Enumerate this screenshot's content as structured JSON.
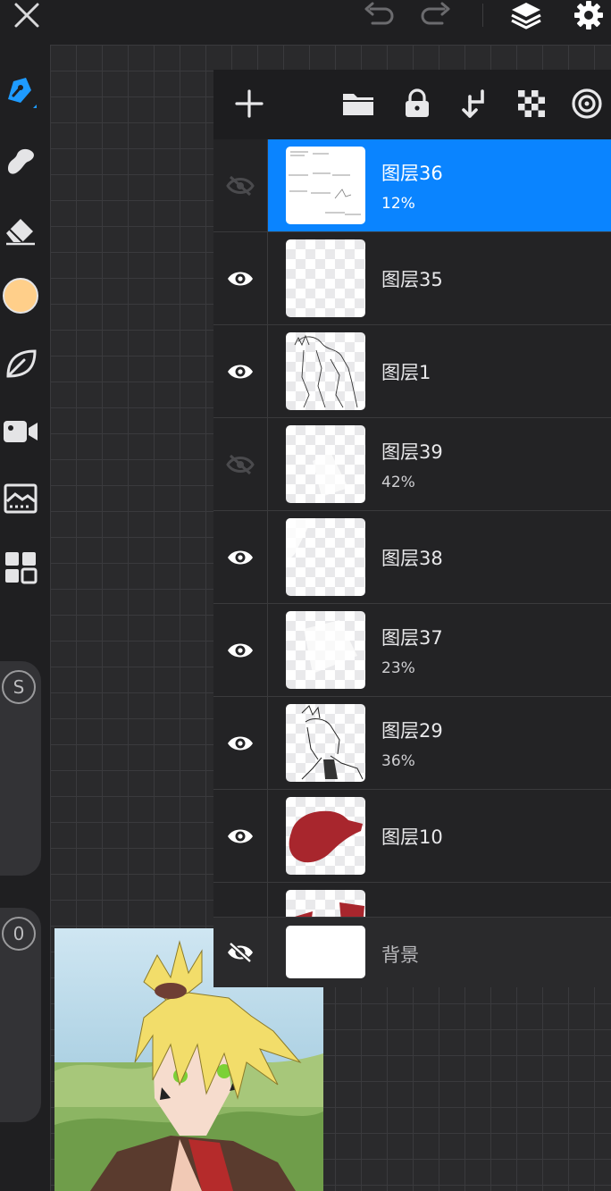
{
  "top_bar": {
    "icons": [
      "close-icon",
      "undo-icon",
      "redo-icon",
      "layers-icon",
      "settings-icon"
    ]
  },
  "left_toolbar": {
    "tools": [
      "brush-icon",
      "smudge-icon",
      "eraser-icon",
      "color-swatch",
      "leaf-icon",
      "camera-icon",
      "reference-image-icon",
      "gallery-grid-icon"
    ],
    "current_color": "#ffcf8a",
    "size_slider_label": "S",
    "opacity_slider_label": "0"
  },
  "layer_panel": {
    "toolbar_icons": [
      "add-layer-icon",
      "folder-icon",
      "lock-icon",
      "merge-down-icon",
      "transparency-icon",
      "blend-mode-icon"
    ],
    "accent_color": "#0a84ff",
    "layers": [
      {
        "name": "图层36",
        "opacity": "12%",
        "visible": false,
        "selected": true
      },
      {
        "name": "图层35",
        "opacity": "",
        "visible": true,
        "selected": false
      },
      {
        "name": "图层1",
        "opacity": "",
        "visible": true,
        "selected": false
      },
      {
        "name": "图层39",
        "opacity": "42%",
        "visible": false,
        "selected": false
      },
      {
        "name": "图层38",
        "opacity": "",
        "visible": true,
        "selected": false
      },
      {
        "name": "图层37",
        "opacity": "23%",
        "visible": true,
        "selected": false
      },
      {
        "name": "图层29",
        "opacity": "36%",
        "visible": true,
        "selected": false
      },
      {
        "name": "图层10",
        "opacity": "",
        "visible": true,
        "selected": false
      }
    ],
    "background_layer": {
      "name": "背景",
      "visible": false
    }
  }
}
